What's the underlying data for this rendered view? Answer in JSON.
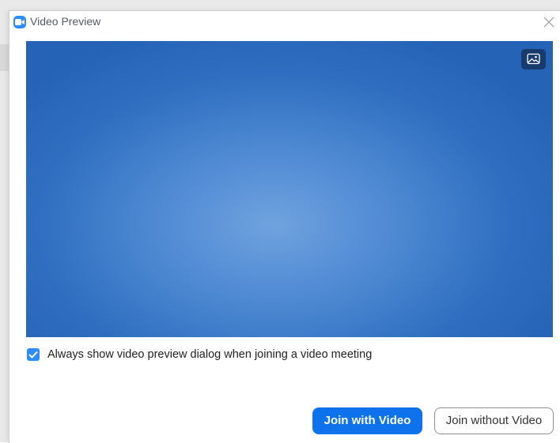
{
  "dialog": {
    "title": "Video Preview",
    "app_icon": "zoom-camera-icon",
    "close_icon": "close-icon"
  },
  "video": {
    "background_button_icon": "virtual-background-icon",
    "colors": {
      "center": "#6fa3df",
      "edge": "#2563b6"
    }
  },
  "options": {
    "always_show_preview": {
      "label": "Always show video preview dialog when joining a video meeting",
      "checked": true
    }
  },
  "actions": {
    "join_with_video": "Join with Video",
    "join_without_video": "Join without Video"
  },
  "colors": {
    "accent": "#0e72ed",
    "checkbox": "#2d8cff"
  }
}
